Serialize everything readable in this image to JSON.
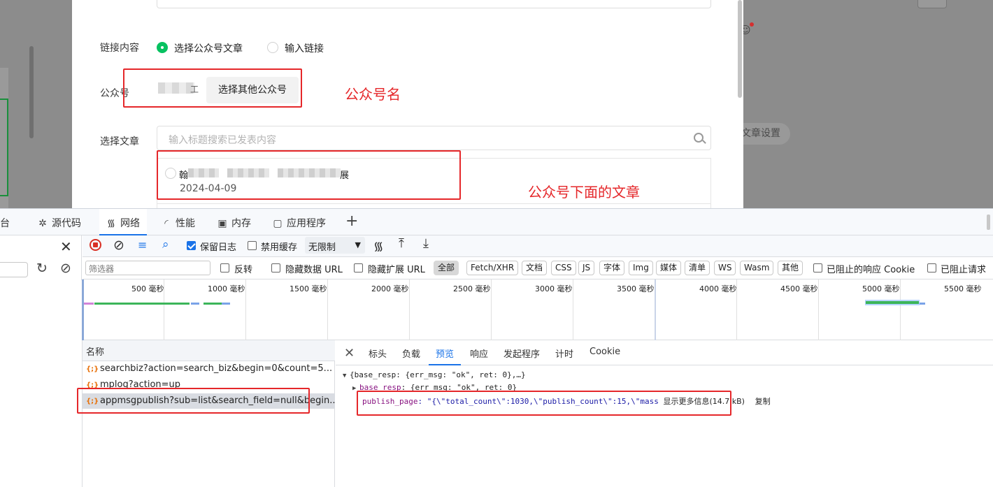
{
  "page": {
    "article_settings": "文章设置"
  },
  "modal": {
    "link_content_label": "链接内容",
    "radio_select_article": "选择公众号文章",
    "radio_input_link": "输入链接",
    "account_label": "公众号",
    "account_name_tail": "工",
    "select_other_button": "选择其他公众号",
    "article_label": "选择文章",
    "search_placeholder": "输入标题搜索已发表内容",
    "article": {
      "title_start": "翰",
      "title_end": "展",
      "date": "2024-04-09"
    }
  },
  "annotations": {
    "account_name": "公众号名",
    "articles": "公众号下面的文章"
  },
  "devtools": {
    "tabs": [
      "台",
      "源代码",
      "网络",
      "性能",
      "内存",
      "应用程序"
    ],
    "toolbar": {
      "preserve_log": "保留日志",
      "disable_cache": "禁用缓存",
      "throttle": "无限制"
    },
    "filter": {
      "placeholder": "筛选器",
      "invert": "反转",
      "hide_data_url": "隐藏数据 URL",
      "hide_ext_url": "隐藏扩展 URL",
      "chips": [
        "全部",
        "Fetch/XHR",
        "文档",
        "CSS",
        "JS",
        "字体",
        "Img",
        "媒体",
        "清单",
        "WS",
        "Wasm",
        "其他"
      ],
      "blocked_cookies": "已阻止的响应 Cookie",
      "blocked_requests": "已阻止请求"
    },
    "timeline_labels": [
      "500 毫秒",
      "1000 毫秒",
      "1500 毫秒",
      "2000 毫秒",
      "2500 毫秒",
      "3000 毫秒",
      "3500 毫秒",
      "4000 毫秒",
      "4500 毫秒",
      "5000 毫秒",
      "5500 毫秒"
    ],
    "name_header": "名称",
    "requests": [
      "searchbiz?action=search_biz&begin=0&count=5...",
      "mplog?action=up",
      "appmsgpublish?sub=list&search_field=null&begin..."
    ],
    "detail_tabs": [
      "标头",
      "负载",
      "预览",
      "响应",
      "发起程序",
      "计时",
      "Cookie"
    ],
    "preview": {
      "line1": "{base_resp: {err_msg: \"ok\", ret: 0},…}",
      "line2_key": "base_resp",
      "line2_val": ": {err_msg: \"ok\", ret: 0}",
      "line3_key": "publish_page",
      "line3_val": ": \"{\\\"total_count\\\":1030,\\\"publish_count\\\":15,\\\"mass",
      "show_more": "显示更多信息",
      "size": "(14.7 kB)",
      "copy": "复制"
    }
  }
}
